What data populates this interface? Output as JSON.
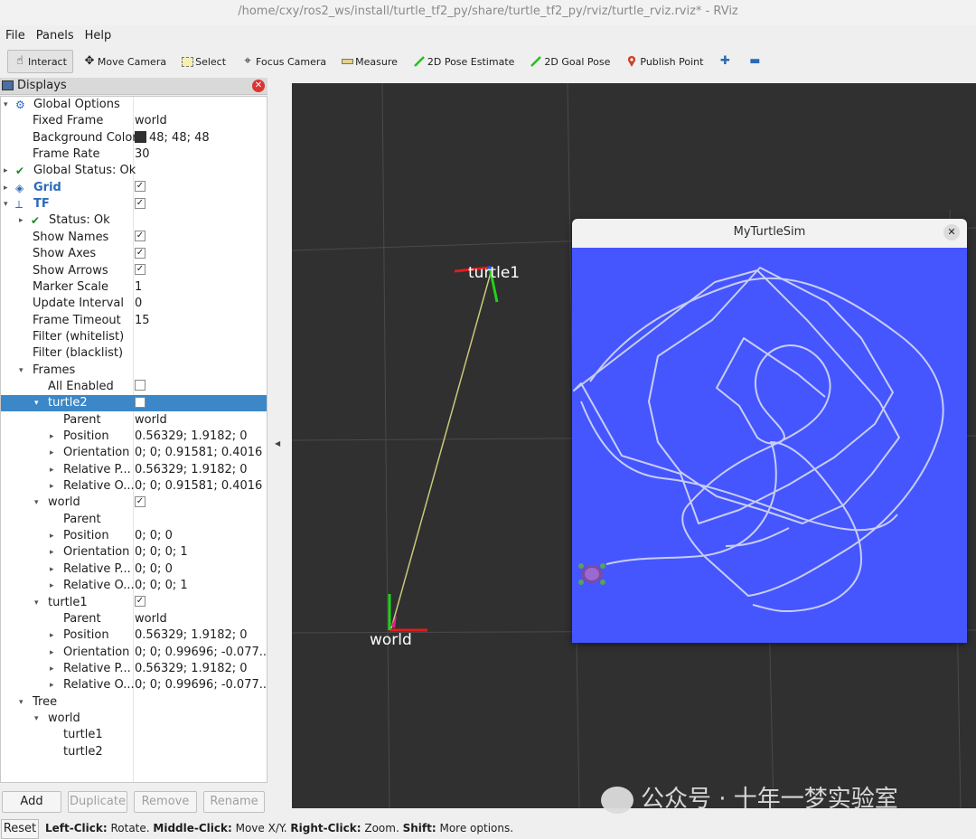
{
  "window": {
    "title": "/home/cxy/ros2_ws/install/turtle_tf2_py/share/turtle_tf2_py/rviz/turtle_rviz.rviz* - RViz"
  },
  "menu": [
    "File",
    "Panels",
    "Help"
  ],
  "toolbar": {
    "interact": "Interact",
    "move_camera": "Move Camera",
    "select": "Select",
    "focus_camera": "Focus Camera",
    "measure": "Measure",
    "pose_estimate": "2D Pose Estimate",
    "goal_pose": "2D Goal Pose",
    "publish_point": "Publish Point",
    "accent_green": "#22c21a",
    "accent_red": "#c8442a",
    "accent_blue": "#2a6ab8"
  },
  "displays": {
    "title": "Displays",
    "rows": [
      {
        "label": "Global Options",
        "value": "",
        "indent": 0,
        "arrow": "▾",
        "icon": "gear-icon"
      },
      {
        "label": "Fixed Frame",
        "value": "world",
        "indent": 1
      },
      {
        "label": "Background Color",
        "value": "48; 48; 48",
        "indent": 1,
        "swatch": "#303030"
      },
      {
        "label": "Frame Rate",
        "value": "30",
        "indent": 1
      },
      {
        "label": "Global Status: Ok",
        "value": "",
        "indent": 0,
        "arrow": "▸",
        "icon": "check-icon"
      },
      {
        "label": "Grid",
        "value": "check",
        "indent": 0,
        "arrow": "▸",
        "icon": "grid-icon",
        "blue": true
      },
      {
        "label": "TF",
        "value": "check",
        "indent": 0,
        "arrow": "▾",
        "icon": "tf-icon",
        "blue": true
      },
      {
        "label": "Status: Ok",
        "value": "",
        "indent": 1,
        "arrow": "▸",
        "icon": "check-icon"
      },
      {
        "label": "Show Names",
        "value": "check",
        "indent": 1
      },
      {
        "label": "Show Axes",
        "value": "check",
        "indent": 1
      },
      {
        "label": "Show Arrows",
        "value": "check",
        "indent": 1
      },
      {
        "label": "Marker Scale",
        "value": "1",
        "indent": 1
      },
      {
        "label": "Update Interval",
        "value": "0",
        "indent": 1
      },
      {
        "label": "Frame Timeout",
        "value": "15",
        "indent": 1
      },
      {
        "label": "Filter (whitelist)",
        "value": "",
        "indent": 1
      },
      {
        "label": "Filter (blacklist)",
        "value": "",
        "indent": 1
      },
      {
        "label": "Frames",
        "value": "",
        "indent": 1,
        "arrow": "▾"
      },
      {
        "label": "All Enabled",
        "value": "uncheck",
        "indent": 2
      },
      {
        "label": "turtle2",
        "value": "uncheck",
        "indent": 2,
        "arrow": "▾",
        "selected": true
      },
      {
        "label": "Parent",
        "value": "world",
        "indent": 3
      },
      {
        "label": "Position",
        "value": "0.56329; 1.9182; 0",
        "indent": 3,
        "arrow": "▸"
      },
      {
        "label": "Orientation",
        "value": "0; 0; 0.91581; 0.4016",
        "indent": 3,
        "arrow": "▸"
      },
      {
        "label": "Relative P...",
        "value": "0.56329; 1.9182; 0",
        "indent": 3,
        "arrow": "▸"
      },
      {
        "label": "Relative O...",
        "value": "0; 0; 0.91581; 0.4016",
        "indent": 3,
        "arrow": "▸"
      },
      {
        "label": "world",
        "value": "check",
        "indent": 2,
        "arrow": "▾"
      },
      {
        "label": "Parent",
        "value": "",
        "indent": 3
      },
      {
        "label": "Position",
        "value": "0; 0; 0",
        "indent": 3,
        "arrow": "▸"
      },
      {
        "label": "Orientation",
        "value": "0; 0; 0; 1",
        "indent": 3,
        "arrow": "▸"
      },
      {
        "label": "Relative P...",
        "value": "0; 0; 0",
        "indent": 3,
        "arrow": "▸"
      },
      {
        "label": "Relative O...",
        "value": "0; 0; 0; 1",
        "indent": 3,
        "arrow": "▸"
      },
      {
        "label": "turtle1",
        "value": "check",
        "indent": 2,
        "arrow": "▾"
      },
      {
        "label": "Parent",
        "value": "world",
        "indent": 3
      },
      {
        "label": "Position",
        "value": "0.56329; 1.9182; 0",
        "indent": 3,
        "arrow": "▸"
      },
      {
        "label": "Orientation",
        "value": "0; 0; 0.99696; -0.077...",
        "indent": 3,
        "arrow": "▸"
      },
      {
        "label": "Relative P...",
        "value": "0.56329; 1.9182; 0",
        "indent": 3,
        "arrow": "▸"
      },
      {
        "label": "Relative O...",
        "value": "0; 0; 0.99696; -0.077...",
        "indent": 3,
        "arrow": "▸"
      },
      {
        "label": "Tree",
        "value": "",
        "indent": 1,
        "arrow": "▾"
      },
      {
        "label": "world",
        "value": "",
        "indent": 2,
        "arrow": "▾"
      },
      {
        "label": "turtle1",
        "value": "",
        "indent": 3
      },
      {
        "label": "turtle2",
        "value": "",
        "indent": 3
      }
    ]
  },
  "buttons": {
    "add": "Add",
    "duplicate": "Duplicate",
    "remove": "Remove",
    "rename": "Rename"
  },
  "status": {
    "reset": "Reset",
    "parts": [
      {
        "b": "Left-Click:",
        "t": " Rotate. "
      },
      {
        "b": "Middle-Click:",
        "t": " Move X/Y. "
      },
      {
        "b": "Right-Click:",
        "t": " Zoom. "
      },
      {
        "b": "Shift:",
        "t": " More options."
      }
    ]
  },
  "scene": {
    "background": "#303030",
    "frame_labels": {
      "turtle1": "turtle1",
      "world": "world"
    }
  },
  "turtlesim": {
    "title": "MyTurtleSim",
    "background": "#4556ff",
    "path_color": "#c8cdf5"
  },
  "watermark": "公众号 · 十年一梦实验室"
}
